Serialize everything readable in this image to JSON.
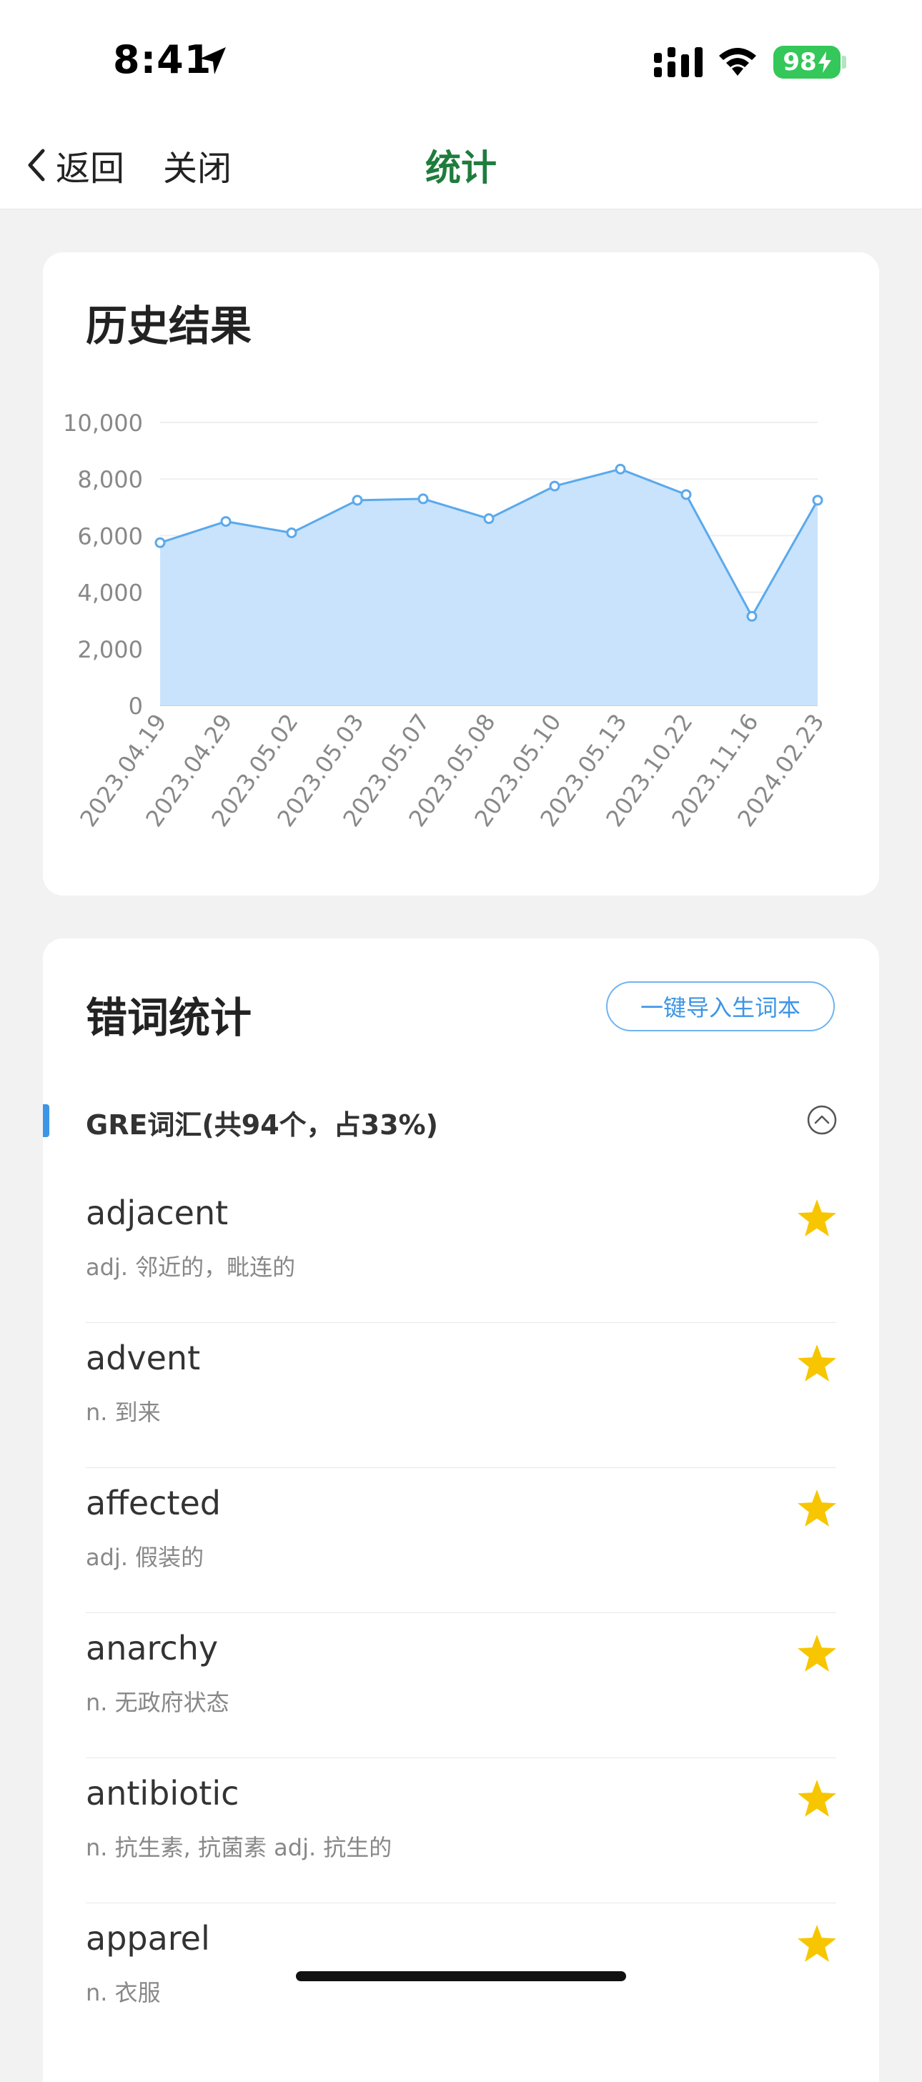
{
  "status_bar": {
    "time": "8:41",
    "battery": "98"
  },
  "nav": {
    "back_label": "返回",
    "close_label": "关闭",
    "title": "统计"
  },
  "history": {
    "title": "历史结果"
  },
  "chart_data": {
    "type": "area",
    "title": "",
    "xlabel": "",
    "ylabel": "",
    "ylim": [
      0,
      10000
    ],
    "yticks": [
      "0",
      "2,000",
      "4,000",
      "6,000",
      "8,000",
      "10,000"
    ],
    "yticks_values": [
      0,
      2000,
      4000,
      6000,
      8000,
      10000
    ],
    "categories": [
      "2023.04.19",
      "2023.04.29",
      "2023.05.02",
      "2023.05.03",
      "2023.05.07",
      "2023.05.08",
      "2023.05.10",
      "2023.05.13",
      "2023.10.22",
      "2023.11.16",
      "2024.02.23"
    ],
    "values": [
      5750,
      6500,
      6100,
      7250,
      7300,
      6600,
      7750,
      8350,
      7450,
      3150,
      7250
    ],
    "grid": true,
    "line_color": "#5aa9ec",
    "fill_color": "#c9e3fc"
  },
  "wrong_words": {
    "title": "错词统计",
    "import_label": "一键导入生词本",
    "section_title": "GRE词汇(共94个，占33%)",
    "items": [
      {
        "word": "adjacent",
        "meaning": "adj. 邻近的，毗连的"
      },
      {
        "word": "advent",
        "meaning": "n. 到来"
      },
      {
        "word": "affected",
        "meaning": "adj. 假装的"
      },
      {
        "word": "anarchy",
        "meaning": "n. 无政府状态"
      },
      {
        "word": "antibiotic",
        "meaning": "n. 抗生素, 抗菌素 adj. 抗生的"
      },
      {
        "word": "apparel",
        "meaning": "n. 衣服"
      }
    ]
  },
  "colors": {
    "accent": "#1e7c3c",
    "link": "#3d95e6",
    "star": "#f7c600"
  }
}
